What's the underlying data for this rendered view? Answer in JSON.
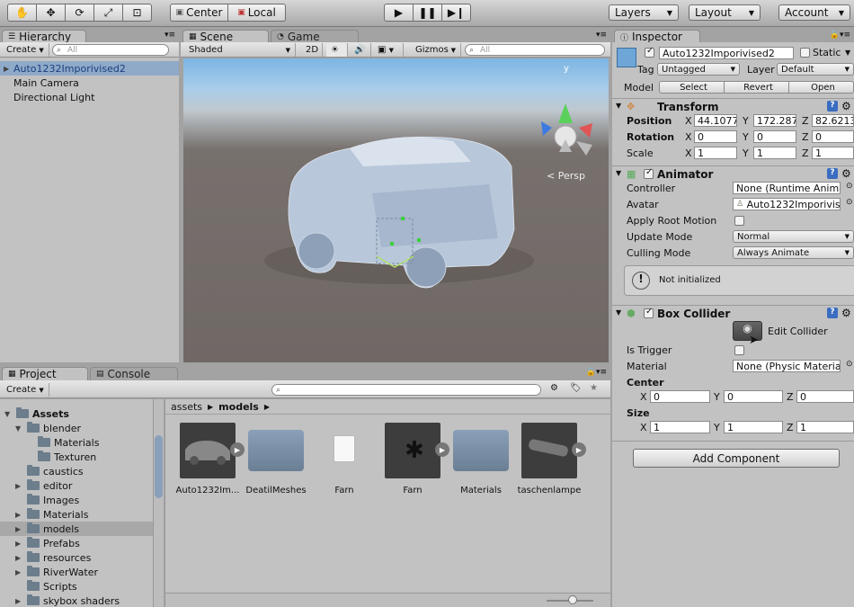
{
  "toolbar": {
    "pivot_label": "Center",
    "space_label": "Local",
    "layers_label": "Layers",
    "layout_label": "Layout",
    "account_label": "Account"
  },
  "hierarchy": {
    "tab_label": "Hierarchy",
    "create_label": "Create",
    "search_placeholder": "All",
    "items": [
      "Auto1232Imporivised2",
      "Main Camera",
      "Directional Light"
    ]
  },
  "scene": {
    "tab_scene": "Scene",
    "tab_game": "Game",
    "shading_mode": "Shaded",
    "mode_2d": "2D",
    "gizmos_label": "Gizmos",
    "search_placeholder": "All",
    "axis_y": "y",
    "persp_label": "Persp"
  },
  "inspector": {
    "tab_label": "Inspector",
    "object_name": "Auto1232Imporivised2",
    "static_label": "Static",
    "tag_label": "Tag",
    "tag_value": "Untagged",
    "layer_label": "Layer",
    "layer_value": "Default",
    "model_label": "Model",
    "select_label": "Select",
    "revert_label": "Revert",
    "open_label": "Open",
    "transform": {
      "title": "Transform",
      "position_label": "Position",
      "rotation_label": "Rotation",
      "scale_label": "Scale",
      "x": "X",
      "y": "Y",
      "z": "Z",
      "position": [
        "44.1077",
        "172.287",
        "82.6213"
      ],
      "rotation": [
        "0",
        "0",
        "0"
      ],
      "scale": [
        "1",
        "1",
        "1"
      ]
    },
    "animator": {
      "title": "Animator",
      "controller_label": "Controller",
      "controller_value": "None (Runtime Anima",
      "avatar_label": "Avatar",
      "avatar_value": "Auto1232Imporivis",
      "apply_root_label": "Apply Root Motion",
      "update_mode_label": "Update Mode",
      "update_mode_value": "Normal",
      "culling_mode_label": "Culling Mode",
      "culling_mode_value": "Always Animate",
      "info_text": "Not initialized"
    },
    "box_collider": {
      "title": "Box Collider",
      "edit_collider_label": "Edit Collider",
      "is_trigger_label": "Is Trigger",
      "material_label": "Material",
      "material_value": "None (Physic Materia",
      "center_label": "Center",
      "size_label": "Size",
      "center": [
        "0",
        "0",
        "0"
      ],
      "size": [
        "1",
        "1",
        "1"
      ]
    },
    "add_component_label": "Add Component"
  },
  "project": {
    "tab_project": "Project",
    "tab_console": "Console",
    "create_label": "Create",
    "breadcrumb": [
      "assets",
      "models"
    ],
    "tree": [
      "Assets",
      "blender",
      "Materials",
      "Texturen",
      "caustics",
      "editor",
      "Images",
      "Materials",
      "models",
      "Prefabs",
      "resources",
      "RiverWater",
      "Scripts",
      "skybox shaders"
    ],
    "assets": [
      "Auto1232Im...",
      "DeatilMeshes",
      "Farn",
      "Farn",
      "Materials",
      "taschenlampe"
    ]
  }
}
